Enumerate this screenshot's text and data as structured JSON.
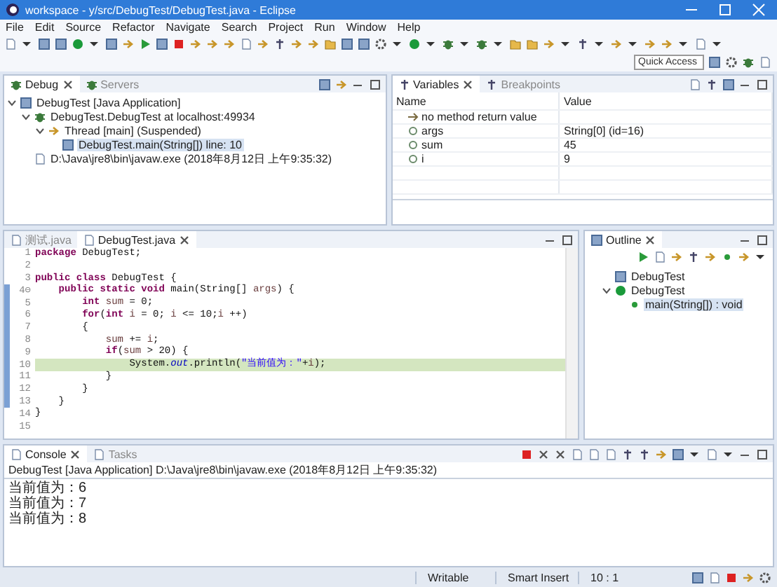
{
  "window": {
    "title": "workspace - y/src/DebugTest/DebugTest.java - Eclipse"
  },
  "menu": [
    "File",
    "Edit",
    "Source",
    "Refactor",
    "Navigate",
    "Search",
    "Project",
    "Run",
    "Window",
    "Help"
  ],
  "quick_access": {
    "placeholder": "Quick Access"
  },
  "debug": {
    "tabs": [
      {
        "label": "Debug",
        "selected": true
      },
      {
        "label": "Servers",
        "selected": false
      }
    ],
    "tree": [
      {
        "kind": "launch",
        "label": "DebugTest [Java Application]",
        "expanded": true,
        "selected": false,
        "children": [
          {
            "kind": "target",
            "label": "DebugTest.DebugTest at localhost:49934",
            "expanded": true,
            "selected": false,
            "children": [
              {
                "kind": "thread",
                "label": "Thread [main] (Suspended)",
                "expanded": true,
                "selected": false,
                "children": [
                  {
                    "kind": "frame",
                    "label": "DebugTest.main(String[]) line: 10",
                    "selected": true
                  }
                ]
              }
            ]
          },
          {
            "kind": "process",
            "label": "D:\\Java\\jre8\\bin\\javaw.exe (2018年8月12日 上午9:35:32)",
            "selected": false
          }
        ]
      }
    ]
  },
  "variables": {
    "tabs": [
      {
        "label": "Variables",
        "selected": true
      },
      {
        "label": "Breakpoints",
        "selected": false
      }
    ],
    "columns": [
      "Name",
      "Value"
    ],
    "rows": [
      {
        "kind": "return",
        "name": "no method return value"
      },
      {
        "kind": "local",
        "name": "args",
        "value": "String[0]  (id=16)"
      },
      {
        "kind": "local",
        "name": "sum",
        "value": "45"
      },
      {
        "kind": "local",
        "name": "i",
        "value": "9"
      }
    ]
  },
  "editor": {
    "tabs": [
      {
        "label": "测试.java",
        "selected": false
      },
      {
        "label": "DebugTest.java",
        "selected": true
      }
    ],
    "lines": [
      {
        "number": "1",
        "segments": [
          {
            "kind": "keyword",
            "text": "package"
          },
          {
            "kind": "plain",
            "text": " DebugTest;"
          }
        ]
      },
      {
        "number": "2"
      },
      {
        "number": "3",
        "segments": [
          {
            "kind": "keyword",
            "text": "public class"
          },
          {
            "kind": "plain",
            "text": " DebugTest {"
          }
        ]
      },
      {
        "number": "4⊖",
        "segments": [
          {
            "kind": "keyword",
            "text": "    public static void"
          },
          {
            "kind": "plain",
            "text": " main(String[] "
          },
          {
            "kind": "param",
            "text": "args"
          },
          {
            "kind": "plain",
            "text": ") {"
          }
        ]
      },
      {
        "number": "5",
        "segments": [
          {
            "kind": "keyword",
            "text": "        int "
          },
          {
            "kind": "local",
            "text": "sum"
          },
          {
            "kind": "plain",
            "text": " = 0;"
          }
        ]
      },
      {
        "number": "6",
        "segments": [
          {
            "kind": "keyword",
            "text": "        for"
          },
          {
            "kind": "plain",
            "text": "("
          },
          {
            "kind": "keyword",
            "text": "int "
          },
          {
            "kind": "local",
            "text": "i"
          },
          {
            "kind": "plain",
            "text": " = 0; "
          },
          {
            "kind": "local",
            "text": "i"
          },
          {
            "kind": "plain",
            "text": " <= 10;"
          },
          {
            "kind": "local",
            "text": "i"
          },
          {
            "kind": "plain",
            "text": " ++)"
          }
        ]
      },
      {
        "number": "7",
        "segments": [
          {
            "kind": "plain",
            "text": "        {"
          }
        ]
      },
      {
        "number": "8",
        "segments": [
          {
            "kind": "local",
            "text": "            sum"
          },
          {
            "kind": "plain",
            "text": " += "
          },
          {
            "kind": "local",
            "text": "i"
          },
          {
            "kind": "plain",
            "text": ";"
          }
        ]
      },
      {
        "number": "9",
        "segments": [
          {
            "kind": "keyword",
            "text": "            if"
          },
          {
            "kind": "plain",
            "text": "("
          },
          {
            "kind": "local",
            "text": "sum"
          },
          {
            "kind": "plain",
            "text": " > 20) {"
          }
        ]
      },
      {
        "number": "10",
        "current": true,
        "segments": [
          {
            "kind": "plain",
            "text": "                System."
          },
          {
            "kind": "field",
            "text": "out"
          },
          {
            "kind": "plain",
            "text": ".println("
          },
          {
            "kind": "string",
            "text": "\"当前值为：\""
          },
          {
            "kind": "plain",
            "text": "+"
          },
          {
            "kind": "local",
            "text": "i"
          },
          {
            "kind": "plain",
            "text": ");"
          }
        ]
      },
      {
        "number": "11",
        "segments": [
          {
            "kind": "plain",
            "text": "            }"
          }
        ]
      },
      {
        "number": "12",
        "segments": [
          {
            "kind": "plain",
            "text": "        }"
          }
        ]
      },
      {
        "number": "13",
        "segments": [
          {
            "kind": "plain",
            "text": "    }"
          }
        ]
      },
      {
        "number": "14",
        "segments": [
          {
            "kind": "plain",
            "text": "}"
          }
        ]
      },
      {
        "number": "15"
      }
    ]
  },
  "outline": {
    "tabs": [
      {
        "label": "Outline",
        "selected": true
      }
    ],
    "tree": [
      {
        "kind": "package",
        "label": "DebugTest",
        "selected": false
      },
      {
        "kind": "class",
        "label": "DebugTest",
        "expanded": true,
        "selected": false,
        "children": [
          {
            "kind": "method",
            "label": "main(String[]) : void",
            "selected": true
          }
        ]
      }
    ]
  },
  "console": {
    "tabs": [
      {
        "label": "Console",
        "selected": true
      },
      {
        "label": "Tasks",
        "selected": false
      }
    ],
    "header": "DebugTest [Java Application] D:\\Java\\jre8\\bin\\javaw.exe (2018年8月12日 上午9:35:32)",
    "lines": [
      "当前值为：6",
      "当前值为：7",
      "当前值为：8"
    ]
  },
  "status_bar": [
    "Writable",
    "Smart Insert",
    "10 : 1"
  ]
}
